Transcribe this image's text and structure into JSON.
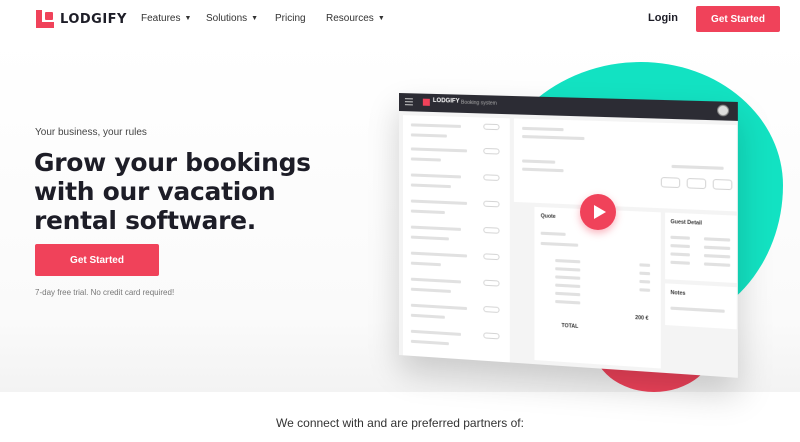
{
  "nav": {
    "brand": "LODGIFY",
    "items": [
      {
        "label": "Features",
        "caret": true
      },
      {
        "label": "Solutions",
        "caret": true
      },
      {
        "label": "Pricing",
        "caret": false
      },
      {
        "label": "Resources",
        "caret": true
      }
    ],
    "login": "Login",
    "cta": "Get Started"
  },
  "hero": {
    "tagline": "Your business, your rules",
    "headline_l1": "Grow your bookings",
    "headline_l2": "with our vacation",
    "headline_l3": "rental software.",
    "cta": "Get Started",
    "note": "7-day free trial. No credit card required!"
  },
  "app": {
    "brand": "LODGIFY",
    "subtitle": "Booking system",
    "quote_title": "Quote",
    "guest_title": "Guest Detail",
    "notes_title": "Notes",
    "total_label": "TOTAL",
    "total_value": "200 €"
  },
  "partners": "We connect with and are preferred partners of:",
  "colors": {
    "accent": "#f0425a",
    "teal": "#12e2c2",
    "dark": "#1d1d27"
  },
  "icons": {
    "play": "play-icon",
    "caret": "chevron-down-icon",
    "menu": "hamburger-icon"
  }
}
